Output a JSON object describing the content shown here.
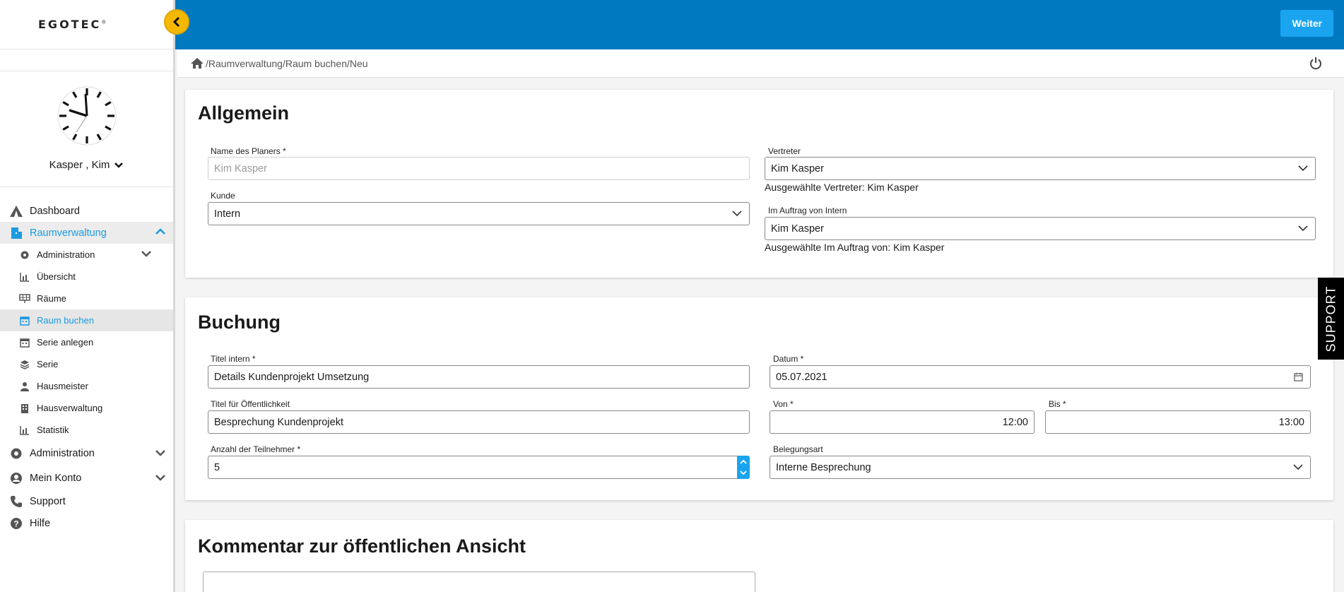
{
  "app": {
    "logo": "EGOTEC",
    "logo_mark": "®"
  },
  "user": {
    "name": "Kasper , Kim"
  },
  "header": {
    "next_button": "Weiter"
  },
  "breadcrumb": {
    "path": "/Raumverwaltung/Raum buchen/Neu"
  },
  "sidebar": {
    "dashboard": "Dashboard",
    "raumverwaltung": "Raumverwaltung",
    "sub": {
      "administration": "Administration",
      "uebersicht": "Übersicht",
      "raeume": "Räume",
      "raum_buchen": "Raum buchen",
      "serie_anlegen": "Serie anlegen",
      "serie": "Serie",
      "hausmeister": "Hausmeister",
      "hausverwaltung": "Hausverwaltung",
      "statistik": "Statistik"
    },
    "administration": "Administration",
    "mein_konto": "Mein Konto",
    "support": "Support",
    "hilfe": "Hilfe"
  },
  "allgemein": {
    "title": "Allgemein",
    "planer_label": "Name des Planers *",
    "planer_value": "Kim Kasper",
    "kunde_label": "Kunde",
    "kunde_value": "Intern",
    "vertreter_label": "Vertreter",
    "vertreter_value": "Kim Kasper",
    "vertreter_hint": "Ausgewählte Vertreter: Kim Kasper",
    "auftrag_label": "Im Auftrag von Intern",
    "auftrag_value": "Kim Kasper",
    "auftrag_hint": "Ausgewählte Im Auftrag von: Kim Kasper"
  },
  "buchung": {
    "title": "Buchung",
    "titel_intern_label": "Titel intern *",
    "titel_intern_value": "Details Kundenprojekt Umsetzung",
    "titel_oeff_label": "Titel für Öffentlichkeit",
    "titel_oeff_value": "Besprechung Kundenprojekt",
    "teilnehmer_label": "Anzahl der Teilnehmer *",
    "teilnehmer_value": "5",
    "datum_label": "Datum *",
    "datum_value": "05.07.2021",
    "von_label": "Von *",
    "von_value": "12:00",
    "bis_label": "Bis *",
    "bis_value": "13:00",
    "belegung_label": "Belegungsart",
    "belegung_value": "Interne Besprechung"
  },
  "kommentar": {
    "title": "Kommentar zur öffentlichen Ansicht"
  },
  "support_tab": "SUPPORT",
  "colors": {
    "primary": "#0079c1",
    "accent": "#1aa4f0",
    "toggle": "#f5b800"
  }
}
